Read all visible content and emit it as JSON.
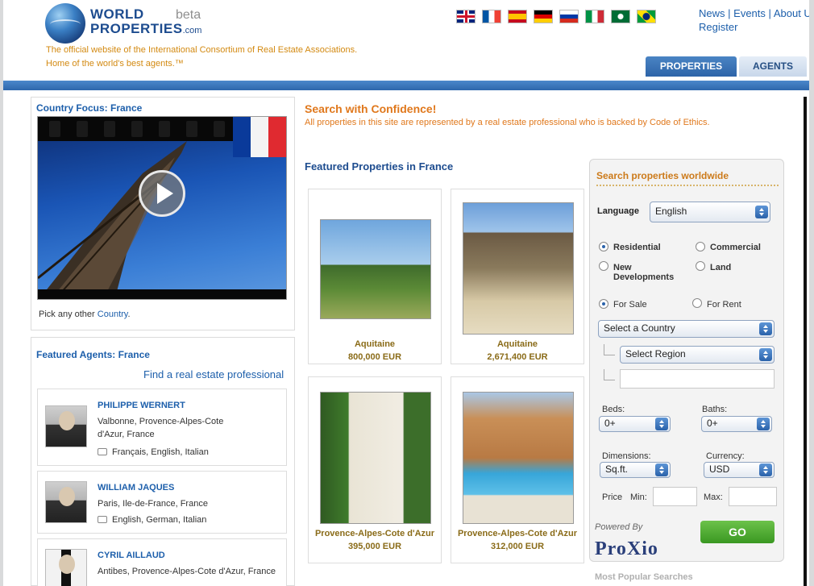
{
  "header": {
    "logo_line1": "WORLD",
    "logo_beta": "beta",
    "logo_line2": "PROPERTIES",
    "logo_com": ".com",
    "tagline1": "The official website of the International Consortium of Real Estate Associations.",
    "tagline2": "Home of the world's best agents.™",
    "flags": [
      "uk-flag",
      "france-flag",
      "spain-flag",
      "germany-flag",
      "russia-flag",
      "italy-flag",
      "saudi-flag",
      "brazil-flag"
    ],
    "links": {
      "news": "News",
      "events": "Events",
      "about": "About U",
      "register": "Register"
    },
    "tabs": {
      "properties": "PROPERTIES",
      "agents": "AGENTS"
    }
  },
  "country_focus": {
    "title": "Country Focus: France",
    "pick_prefix": "Pick any other ",
    "pick_link": "Country",
    "pick_suffix": "."
  },
  "featured_agents": {
    "title": "Featured Agents: France",
    "find_link": "Find a real estate professional",
    "agents": [
      {
        "name": "PHILIPPE WERNERT",
        "location": "Valbonne, Provence-Alpes-Cote d'Azur, France",
        "languages": "Français, English, Italian"
      },
      {
        "name": "WILLIAM JAQUES",
        "location": "Paris, Ile-de-France, France",
        "languages": "English, German, Italian"
      },
      {
        "name": "CYRIL AILLAUD",
        "location": "Antibes, Provence-Alpes-Cote d'Azur, France",
        "languages": ""
      }
    ]
  },
  "main": {
    "confidence_title": "Search with Confidence!",
    "confidence_text": "All properties in this site are represented by a real estate professional who is backed by Code of Ethics.",
    "featured_title": "Featured Properties in France",
    "properties": [
      {
        "region": "Aquitaine",
        "price": "800,000 EUR"
      },
      {
        "region": "Aquitaine",
        "price": "2,671,400 EUR"
      },
      {
        "region": "Provence-Alpes-Cote d'Azur",
        "price": "395,000 EUR"
      },
      {
        "region": "Provence-Alpes-Cote d'Azur",
        "price": "312,000 EUR"
      }
    ]
  },
  "search": {
    "title": "Search properties worldwide",
    "language_label": "Language",
    "language_value": "English",
    "type_options": {
      "residential": "Residential",
      "commercial": "Commercial",
      "new_dev": "New Developments",
      "land": "Land"
    },
    "selected_type": "Residential",
    "sale_options": {
      "for_sale": "For Sale",
      "for_rent": "For Rent"
    },
    "selected_sale": "For Sale",
    "country_placeholder": "Select a Country",
    "region_placeholder": "Select  Region",
    "beds_label": "Beds:",
    "beds_value": "0+",
    "baths_label": "Baths:",
    "baths_value": "0+",
    "dimensions_label": "Dimensions:",
    "dimensions_value": "Sq.ft.",
    "currency_label": "Currency:",
    "currency_value": "USD",
    "price_label": "Price",
    "min_label": "Min:",
    "max_label": "Max:",
    "go_label": "GO",
    "powered_by": "Powered By",
    "powered_logo": "ProXio",
    "most_popular": "Most Popular Searches"
  }
}
